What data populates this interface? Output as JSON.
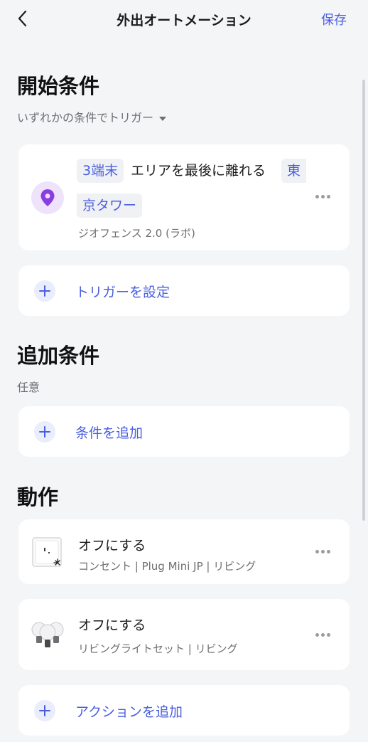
{
  "header": {
    "back_icon": "chevron-left-icon",
    "title": "外出オートメーション",
    "save_label": "保存",
    "accent_color": "#4a5fe0"
  },
  "start_conditions": {
    "title": "開始条件",
    "mode_label": "いずれかの条件でトリガー",
    "mode_icon": "caret-down-icon",
    "trigger": {
      "icon": "location-pin-icon",
      "icon_color": "#8a3ee0",
      "device_tag": "3端末",
      "event_text": "エリアを最後に離れる",
      "place_tag_part1": "東",
      "place_tag_part2": "京タワー",
      "subtitle": "ジオフェンス 2.0 (ラボ)"
    },
    "add_label": "トリガーを設定"
  },
  "additional_conditions": {
    "title": "追加条件",
    "subtitle": "任意",
    "add_label": "条件を追加"
  },
  "actions": {
    "title": "動作",
    "items": [
      {
        "icon": "smart-plug-icon",
        "title": "オフにする",
        "subtitle": "コンセント | Plug Mini JP | リビング"
      },
      {
        "icon": "light-bulbs-icon",
        "title": "オフにする",
        "subtitle": "リビングライトセット | リビング"
      }
    ],
    "add_label": "アクションを追加"
  }
}
